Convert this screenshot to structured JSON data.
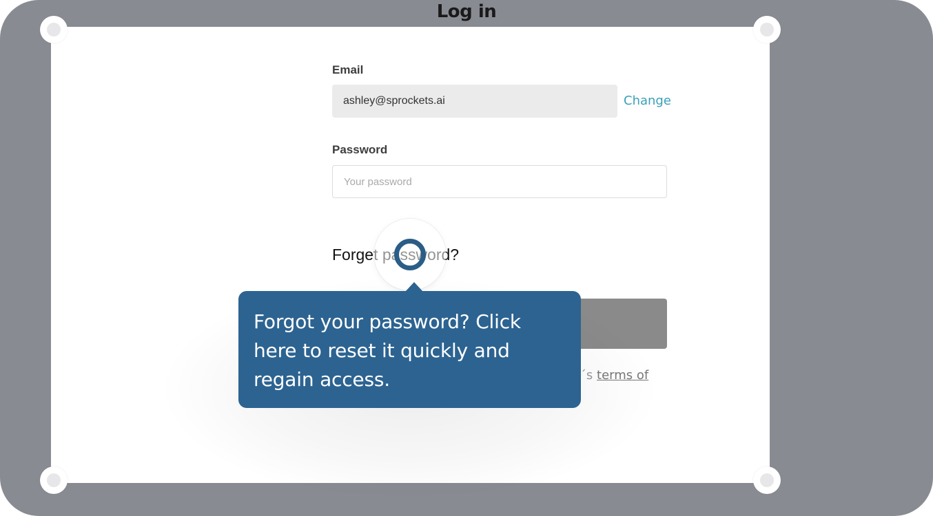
{
  "window": {
    "title": "Log in"
  },
  "form": {
    "email_label": "Email",
    "email_value": "ashley@sprockets.ai",
    "change_label": "Change",
    "password_label": "Password",
    "password_placeholder": "Your password",
    "forgot_password_label": "Forget password?",
    "terms_prefix": "ket´s ",
    "terms_link": "terms of"
  },
  "tooltip": {
    "text": "Forgot your password? Click here to reset it quickly and regain access."
  },
  "colors": {
    "frame": "#898b93",
    "link_accent": "#3aa0b9",
    "tooltip_bg": "#2c6391",
    "hotspot_ring": "#2a5d87",
    "button_gray": "#8a8a8a"
  }
}
